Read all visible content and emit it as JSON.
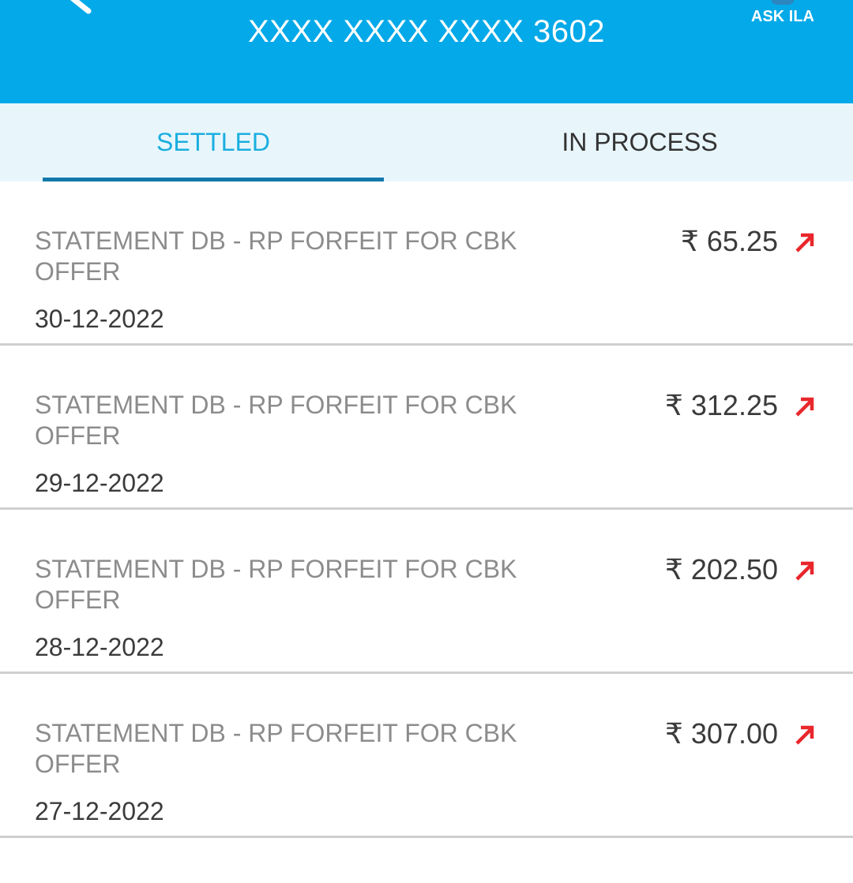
{
  "header": {
    "title": "XXXX XXXX XXXX 3602",
    "back_icon": "back-arrow-icon",
    "ask_ila_label": "ASK ILA",
    "background_color": "#03a9e8"
  },
  "tabs": [
    {
      "label": "SETTLED",
      "active": true
    },
    {
      "label": "IN PROCESS",
      "active": false
    }
  ],
  "transactions": [
    {
      "description": "STATEMENT DB - RP FORFEIT FOR CBK OFFER",
      "date": "30-12-2022",
      "amount": "₹ 65.25",
      "direction_icon": "debit-arrow-icon",
      "direction_color": "#e8262b"
    },
    {
      "description": "STATEMENT DB - RP FORFEIT FOR CBK OFFER",
      "date": "29-12-2022",
      "amount": "₹ 312.25",
      "direction_icon": "debit-arrow-icon",
      "direction_color": "#e8262b"
    },
    {
      "description": "STATEMENT DB - RP FORFEIT FOR CBK OFFER",
      "date": "28-12-2022",
      "amount": "₹ 202.50",
      "direction_icon": "debit-arrow-icon",
      "direction_color": "#e8262b"
    },
    {
      "description": "STATEMENT DB - RP FORFEIT FOR CBK OFFER",
      "date": "27-12-2022",
      "amount": "₹ 307.00",
      "direction_icon": "debit-arrow-icon",
      "direction_color": "#e8262b"
    }
  ]
}
